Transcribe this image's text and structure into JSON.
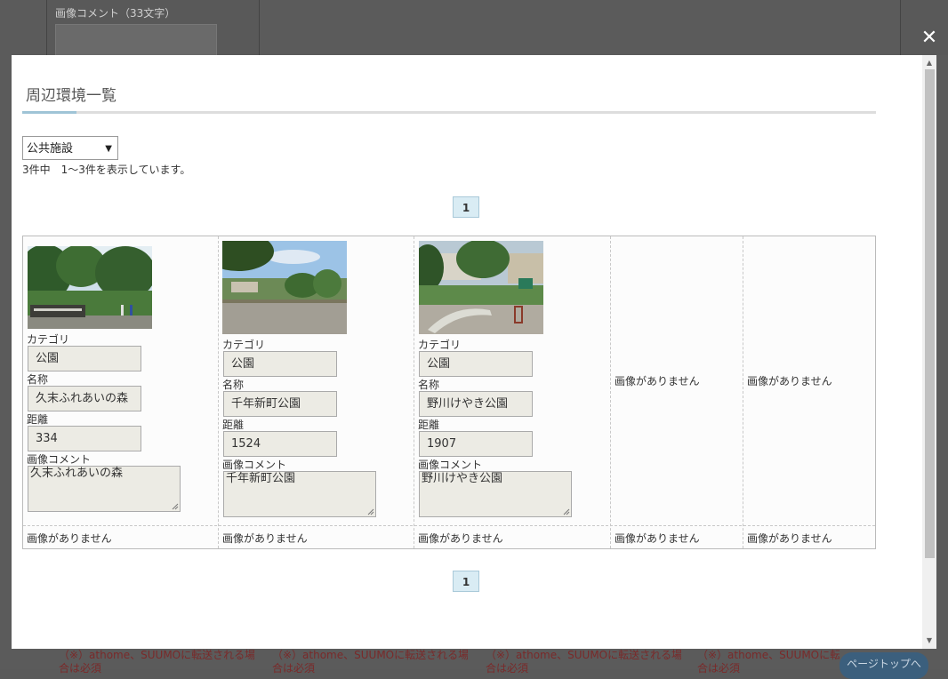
{
  "background": {
    "image_comment_label": "画像コメント（33文字）",
    "warning_text": "（※）athome、SUUMOに転送される場合は必須",
    "warning_text_line2": "合は必須",
    "page_top_label": "ページトップへ"
  },
  "modal": {
    "title": "周辺環境一覧",
    "close_icon": "close-icon",
    "category_select": {
      "selected": "公共施設"
    },
    "count_text": "3件中　1〜3件を表示しています。",
    "page_current": "1",
    "items": [
      {
        "category_label": "カテゴリ",
        "category": "公園",
        "name_label": "名称",
        "name": "久末ふれあいの森",
        "distance_label": "距離",
        "distance": "334",
        "comment_label": "画像コメント",
        "comment": "久末ふれあいの森"
      },
      {
        "category_label": "カテゴリ",
        "category": "公園",
        "name_label": "名称",
        "name": "千年新町公園",
        "distance_label": "距離",
        "distance": "1524",
        "comment_label": "画像コメント",
        "comment": "千年新町公園"
      },
      {
        "category_label": "カテゴリ",
        "category": "公園",
        "name_label": "名称",
        "name": "野川けやき公園",
        "distance_label": "距離",
        "distance": "1907",
        "comment_label": "画像コメント",
        "comment": "野川けやき公園"
      }
    ],
    "no_image_text": "画像がありません"
  }
}
